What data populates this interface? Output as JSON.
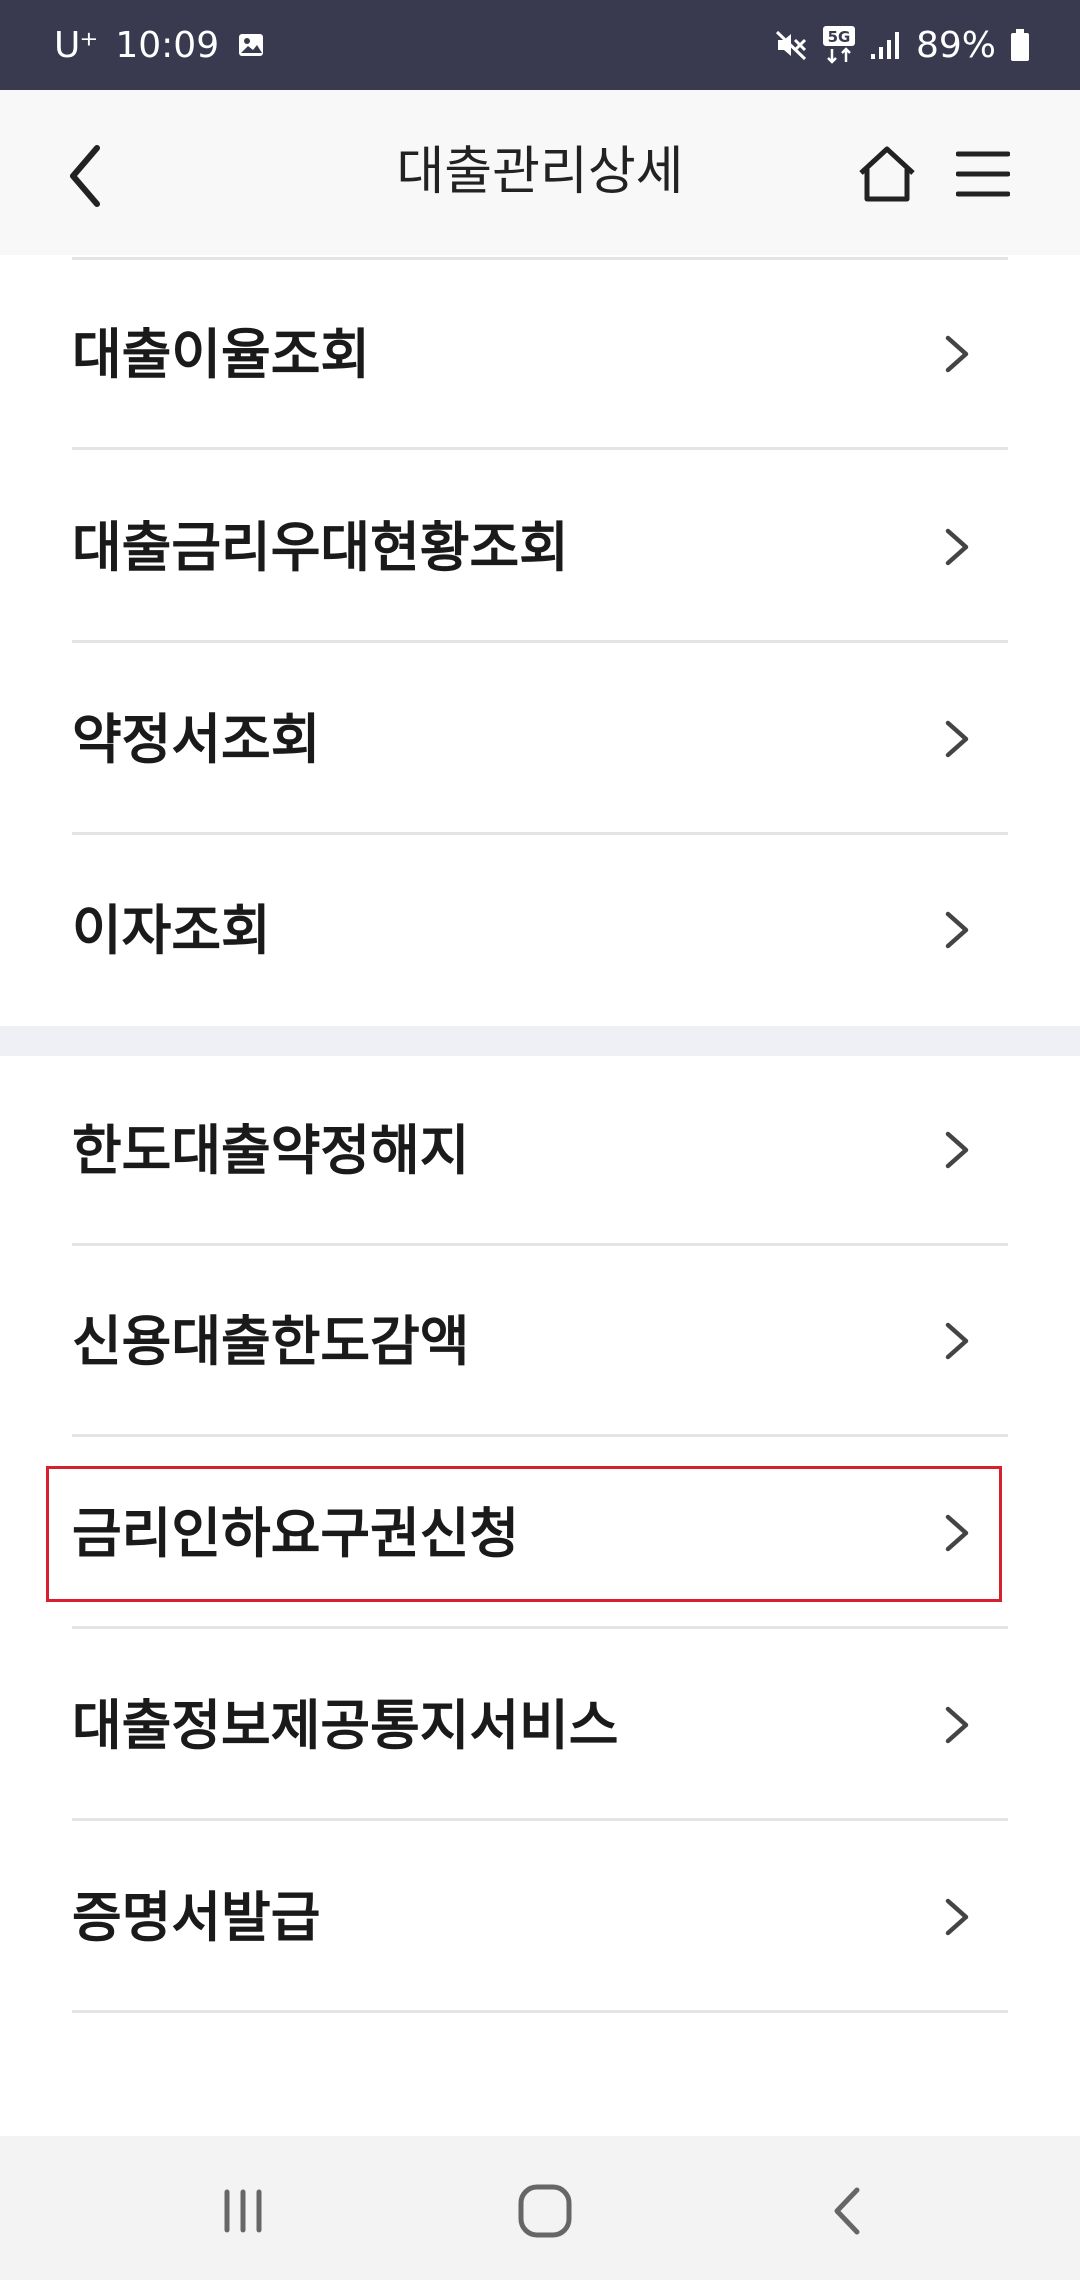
{
  "status_bar": {
    "carrier": "U⁺",
    "time": "10:09",
    "network_type": "5G",
    "battery_percent": "89%",
    "icons": [
      "image-notification-icon",
      "mute-icon",
      "5g-data-icon",
      "signal-icon",
      "battery-icon"
    ]
  },
  "header": {
    "title": "대출관리상세",
    "back_icon": "chevron-left-icon",
    "home_icon": "home-icon",
    "menu_icon": "hamburger-menu-icon"
  },
  "menu_group_1": [
    {
      "label": "대출이율조회"
    },
    {
      "label": "대출금리우대현황조회"
    },
    {
      "label": "약정서조회"
    },
    {
      "label": "이자조회"
    }
  ],
  "menu_group_2": [
    {
      "label": "한도대출약정해지"
    },
    {
      "label": "신용대출한도감액"
    },
    {
      "label": "금리인하요구권신청",
      "highlighted": true
    },
    {
      "label": "대출정보제공통지서비스"
    },
    {
      "label": "증명서발급"
    }
  ],
  "colors": {
    "status_bar_bg": "#393a4f",
    "header_bg": "#f8f8f8",
    "highlight": "#d7202e",
    "divider": "#e4e4e4",
    "section_gap": "#eef0f5",
    "nav_bar_bg": "#f3f3f3"
  },
  "nav_bar": {
    "icons": [
      "recent-apps-icon",
      "home-circle-icon",
      "system-back-icon"
    ]
  }
}
